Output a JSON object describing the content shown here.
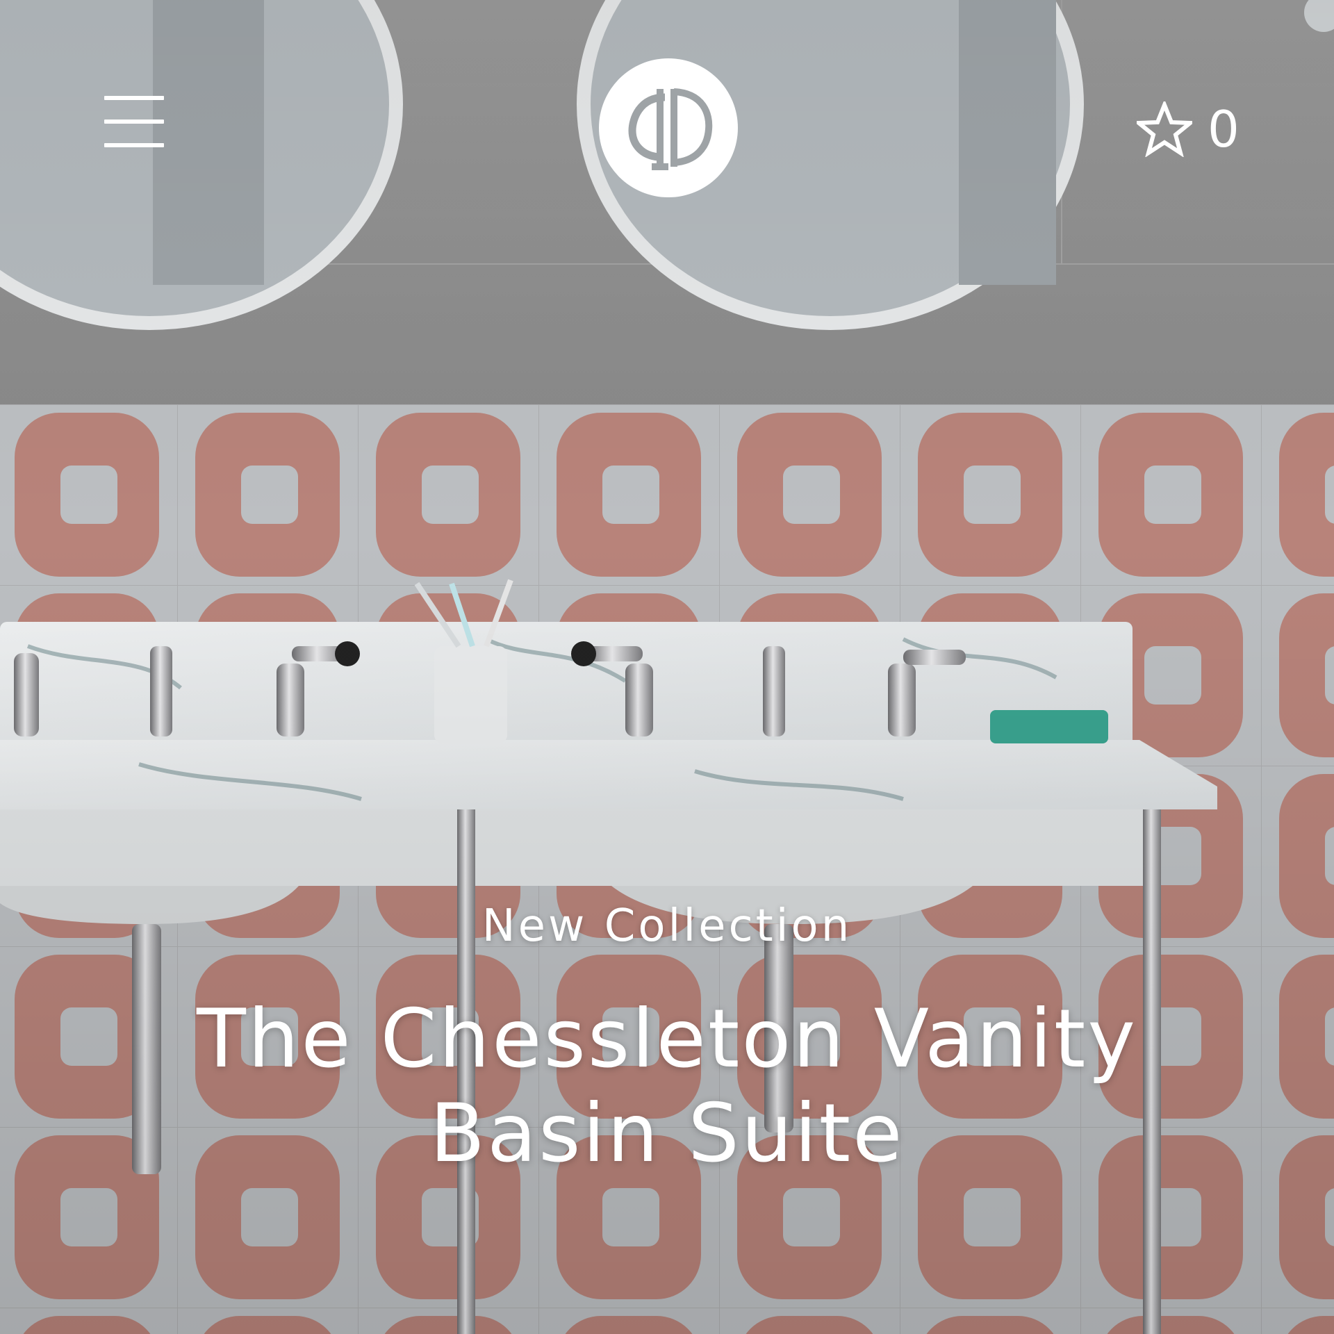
{
  "header": {
    "menu_icon": "hamburger-menu-icon",
    "logo_icon": "brand-monogram-logo",
    "favourites_icon": "star-outline-icon",
    "favourites_count": "0"
  },
  "hero": {
    "background_image": "bathroom-vanity-photo",
    "eyebrow": "New Collection",
    "title_line1": "The Chessleton Vanity",
    "title_line2": "Basin Suite"
  },
  "colors": {
    "text": "#ffffff",
    "wall": "#8f8f8f",
    "tile_pink": "#c08a80",
    "tile_light": "#c4c9cc",
    "accent_teal": "#3aa38f"
  }
}
